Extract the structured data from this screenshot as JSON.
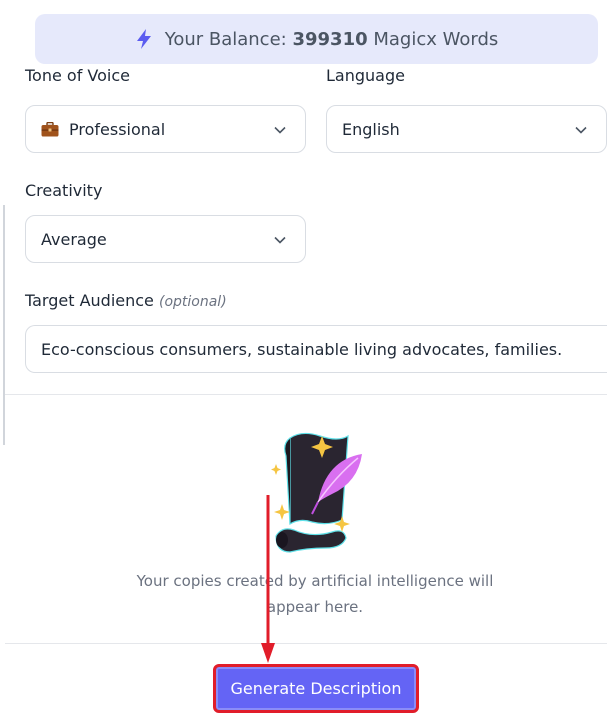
{
  "balance": {
    "prefix": "Your Balance:",
    "amount": "399310",
    "suffix": "Magicx Words"
  },
  "clipped_labels": {
    "tone": "Tone of Voice",
    "language": "Language"
  },
  "tone_select": {
    "value": "Professional"
  },
  "language_select": {
    "value": "English"
  },
  "creativity": {
    "label": "Creativity",
    "value": "Average"
  },
  "target_audience": {
    "label": "Target Audience",
    "optional": "(optional)",
    "value": "Eco-conscious consumers, sustainable living advocates, families."
  },
  "empty_state": {
    "message_line1": "Your copies created by artificial intelligence will",
    "message_line2": "appear here."
  },
  "generate_button": {
    "label": "Generate Description"
  },
  "colors": {
    "accent": "#6464f5",
    "annotation": "#e11d2a",
    "balance_bg": "#e6e9fb"
  }
}
